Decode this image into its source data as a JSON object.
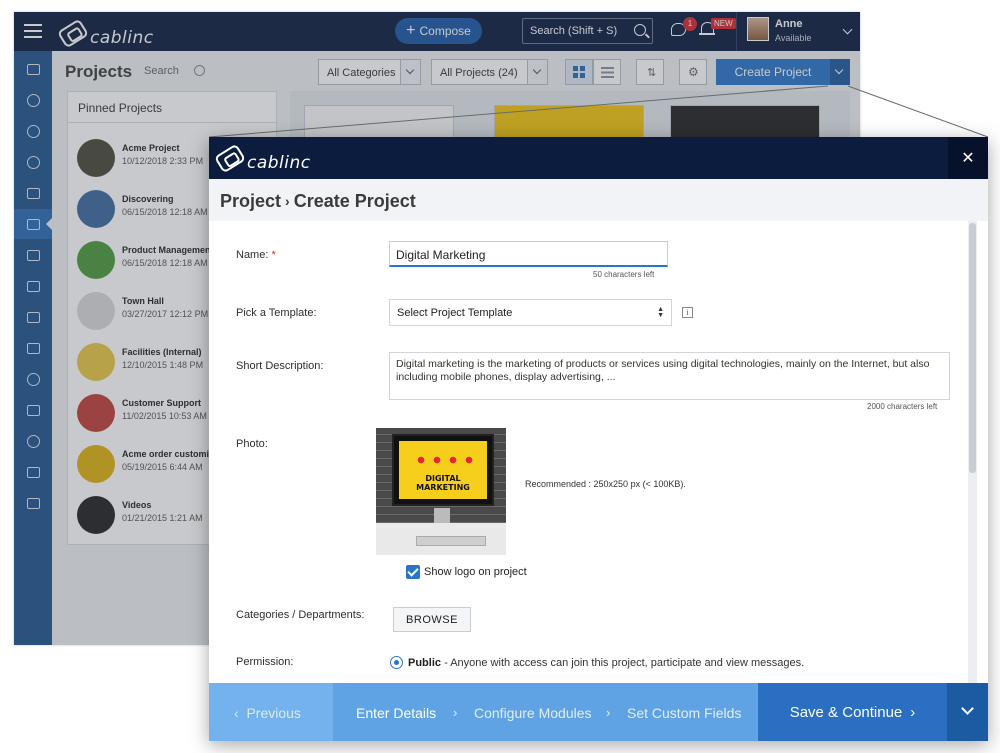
{
  "app": {
    "brand": "cablinc",
    "compose_label": "Compose",
    "search_placeholder": "Search (Shift + S)",
    "chat_badge": "1",
    "notification_badge": "NEW",
    "user": {
      "name": "Anne",
      "status": "Available"
    },
    "nav_icons": [
      "inbox-icon",
      "dashboard-icon",
      "user-icon",
      "reports-icon",
      "people-icon",
      "projects-icon",
      "documents-icon",
      "table-icon",
      "calendar-icon",
      "trophy-icon",
      "badge-icon",
      "mail-icon",
      "help-icon",
      "analytics-icon",
      "tag-icon"
    ],
    "projects_title": "Projects",
    "projects_search_label": "Search",
    "category_filter": "All Categories",
    "project_filter": "All Projects (24)",
    "create_project_label": "Create Project",
    "pinned_header": "Pinned Projects",
    "pinned": [
      {
        "name": "Acme Project",
        "date": "10/12/2018 2:33 PM"
      },
      {
        "name": "Discovering",
        "date": "06/15/2018 12:18 AM"
      },
      {
        "name": "Product Management",
        "date": "06/15/2018 12:18 AM"
      },
      {
        "name": "Town Hall",
        "date": "03/27/2017 12:12 PM"
      },
      {
        "name": "Facilities (Internal)",
        "date": "12/10/2015 1:48 PM"
      },
      {
        "name": "Customer Support",
        "date": "11/02/2015 10:53 AM"
      },
      {
        "name": "Acme order customization",
        "date": "05/19/2015 6:44 AM"
      },
      {
        "name": "Videos",
        "date": "01/21/2015 1:21 AM"
      }
    ],
    "pin_colors": [
      "#4a4a3a",
      "#3d6aa0",
      "#4c9a3c",
      "#d9d9d9",
      "#e8c844",
      "#c0403a",
      "#e0b010",
      "#222222"
    ]
  },
  "modal": {
    "brand": "cablinc",
    "close_label": "✕",
    "breadcrumb_parent": "Project",
    "breadcrumb_sep": "›",
    "breadcrumb_current": "Create Project",
    "name_label": "Name:",
    "required_mark": "*",
    "name_value": "Digital Marketing",
    "name_hint": "50 characters left",
    "template_label": "Pick a Template:",
    "template_value": "Select Project Template",
    "template_info": "i",
    "desc_label": "Short Description:",
    "desc_value": "Digital marketing is the marketing of products or services using digital technologies, mainly on the Internet, but also including mobile phones, display advertising, ...",
    "desc_hint": "2000 characters left",
    "photo_label": "Photo:",
    "photo_text": "DIGITAL MARKETING",
    "photo_recommend": "Recommended : 250x250 px (< 100KB).",
    "show_logo_label": "Show logo on project",
    "show_logo_checked": true,
    "categories_label": "Categories / Departments:",
    "browse_label": "BROWSE",
    "permission_label": "Permission:",
    "permission_option": "Public",
    "permission_desc": "- Anyone with access can join this project, participate and view messages."
  },
  "wizard": {
    "prev_label": "Previous",
    "steps": [
      "Enter Details",
      "Configure Modules",
      "Set Custom Fields"
    ],
    "current_step": 0,
    "save_label": "Save & Continue",
    "save_chev": "›",
    "step_chev": "›",
    "prev_chev": "‹"
  }
}
